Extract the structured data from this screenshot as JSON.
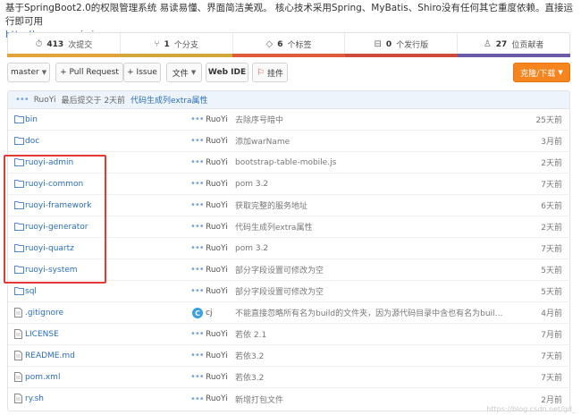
{
  "description": {
    "text": "基于SpringBoot2.0的权限管理系统 易读易懂、界面简洁美观。 核心技术采用Spring、MyBatis、Shiro没有任何其它重度依赖。直接运行即可用",
    "url": "http://www.ruoyi.vip"
  },
  "stats": [
    {
      "icon": "commit-icon",
      "glyph": "⏱",
      "count": "413",
      "label": "次提交"
    },
    {
      "icon": "branch-icon",
      "glyph": "⑂",
      "count": "1",
      "label": "个分支"
    },
    {
      "icon": "tag-icon",
      "glyph": "◇",
      "count": "6",
      "label": "个标签"
    },
    {
      "icon": "release-icon",
      "glyph": "⊟",
      "count": "0",
      "label": "个发行版"
    },
    {
      "icon": "contributors-icon",
      "glyph": "♙",
      "count": "27",
      "label": "位贡献者"
    }
  ],
  "lang_colors": [
    "#e0a43a",
    "#d2a83b",
    "#e05a3c",
    "#d04a3a",
    "#6a5aa8"
  ],
  "toolbar": {
    "branch": "master",
    "pull_request": "+ Pull Request",
    "issue": "+ Issue",
    "file_menu": "文件",
    "web_ide": "Web IDE",
    "widget": "挂件",
    "clone_download": "克隆/下载"
  },
  "last_commit": {
    "author": "RuoYi",
    "text": "最后提交于 2天前",
    "message": "代码生成列extra属性"
  },
  "files": [
    {
      "type": "folder",
      "name": "bin",
      "author": "RuoYi",
      "message": "去除序号暗中",
      "time": "25天前"
    },
    {
      "type": "folder",
      "name": "doc",
      "author": "RuoYi",
      "message": "添加warName",
      "time": "3月前"
    },
    {
      "type": "folder",
      "name": "ruoyi-admin",
      "author": "RuoYi",
      "message": "bootstrap-table-mobile.js",
      "time": "2天前"
    },
    {
      "type": "folder",
      "name": "ruoyi-common",
      "author": "RuoYi",
      "message": "pom 3.2",
      "time": "7天前"
    },
    {
      "type": "folder",
      "name": "ruoyi-framework",
      "author": "RuoYi",
      "message": "获取完整的服务地址",
      "time": "6天前"
    },
    {
      "type": "folder",
      "name": "ruoyi-generator",
      "author": "RuoYi",
      "message": "代码生成列extra属性",
      "time": "2天前"
    },
    {
      "type": "folder",
      "name": "ruoyi-quartz",
      "author": "RuoYi",
      "message": "pom 3.2",
      "time": "7天前"
    },
    {
      "type": "folder",
      "name": "ruoyi-system",
      "author": "RuoYi",
      "message": "部分字段设置可修改为空",
      "time": "5天前"
    },
    {
      "type": "folder",
      "name": "sql",
      "author": "RuoYi",
      "message": "部分字段设置可修改为空",
      "time": "5天前"
    },
    {
      "type": "file",
      "name": ".gitignore",
      "author": "cj",
      "avatar": "C",
      "message": "不能直接忽略所有名为build的文件夹，因为源代码目录中含也有名为build的...",
      "time": "4月前"
    },
    {
      "type": "file",
      "name": "LICENSE",
      "author": "RuoYi",
      "message": "若依 2.1",
      "time": "7月前"
    },
    {
      "type": "file",
      "name": "README.md",
      "author": "RuoYi",
      "message": "若依3.2",
      "time": "7天前"
    },
    {
      "type": "file",
      "name": "pom.xml",
      "author": "RuoYi",
      "message": "若依3.2",
      "time": "7天前"
    },
    {
      "type": "file",
      "name": "ry.sh",
      "author": "RuoYi",
      "message": "新增打包文件",
      "time": "2月前"
    }
  ],
  "watermark": "https://blog.csdn.net/gd_"
}
